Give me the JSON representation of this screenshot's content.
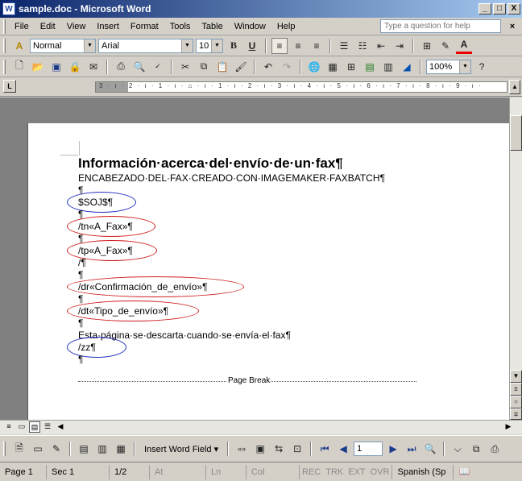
{
  "window": {
    "title": "sample.doc - Microsoft Word",
    "min": "_",
    "max": "□",
    "close": "X"
  },
  "menubar": {
    "items": [
      "File",
      "Edit",
      "View",
      "Insert",
      "Format",
      "Tools",
      "Table",
      "Window",
      "Help"
    ],
    "help_placeholder": "Type a question for help",
    "close": "×"
  },
  "formatting": {
    "style": "Normal",
    "font": "Arial",
    "size": "10"
  },
  "standard": {
    "zoom": "100%"
  },
  "ruler": {
    "numbers": "3 · ı · 2 · ı · 1 · ı · ⌂ · ı · 1 · ı · 2 · ı · 3 · ı · 4 · ı · 5 · ı · 6 · ı · 7 · ı · 8 · ı · 9 · ı ·"
  },
  "document": {
    "heading": "Información·acerca·del·envío·de·un·fax¶",
    "lines": [
      "ENCABEZADO·DEL·FAX·CREADO·CON·IMAGEMAKER·FAXBATCH¶",
      "¶",
      "$SOJ$¶",
      "¶",
      "/tn«A_Fax»¶",
      "¶",
      "/tp«A_Fax»¶",
      "/¶",
      "¶",
      "/dr«Confirmación_de_envío»¶",
      "¶",
      "/dt«Tipo_de_envío»¶",
      "¶",
      "Esta·página·se·descarta·cuando·se·envía·el·fax¶",
      "/zz¶",
      "¶"
    ],
    "page_break": "Page Break"
  },
  "mailmerge": {
    "insert_word_field": "Insert Word Field ▾",
    "record": "1"
  },
  "status": {
    "page": "Page 1",
    "sec": "Sec 1",
    "pages": "1/2",
    "at": "At",
    "ln": "Ln",
    "col": "Col",
    "rec": "REC",
    "trk": "TRK",
    "ext": "EXT",
    "ovr": "OVR",
    "language": "Spanish (Sp"
  }
}
